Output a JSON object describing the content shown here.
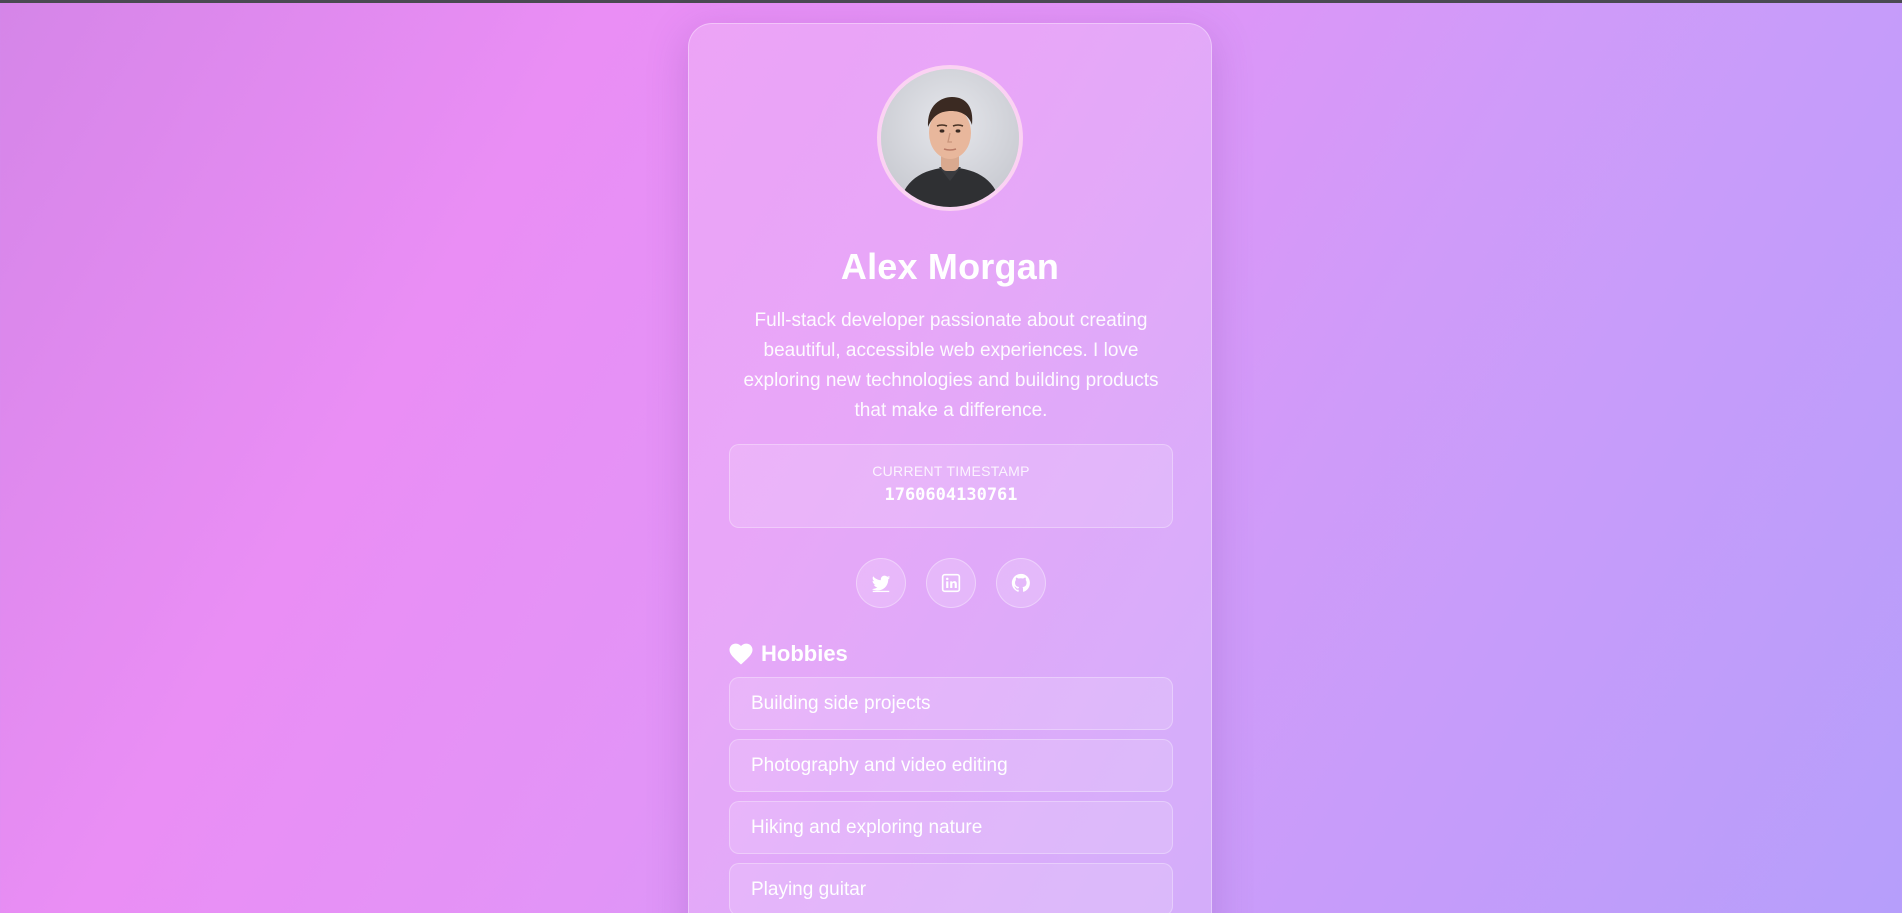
{
  "profile": {
    "name": "Alex Morgan",
    "bio": "Full-stack developer passionate about creating beautiful, accessible web experiences. I love exploring new technologies and building products that make a difference.",
    "avatar_alt": "Alex Morgan"
  },
  "timestamp": {
    "label": "CURRENT TIMESTAMP",
    "value": "1760604130761"
  },
  "social": [
    {
      "icon": "twitter-icon",
      "label": "Twitter"
    },
    {
      "icon": "linkedin-icon",
      "label": "LinkedIn"
    },
    {
      "icon": "github-icon",
      "label": "GitHub"
    }
  ],
  "hobbies": {
    "title": "Hobbies",
    "icon": "heart-icon",
    "items": [
      {
        "label": "Building side projects"
      },
      {
        "label": "Photography and video editing"
      },
      {
        "label": "Hiking and exploring nature"
      },
      {
        "label": "Playing guitar"
      }
    ]
  },
  "colors": {
    "background_start": "#d585e8",
    "background_end": "#b69efb",
    "text": "#ffffff"
  }
}
